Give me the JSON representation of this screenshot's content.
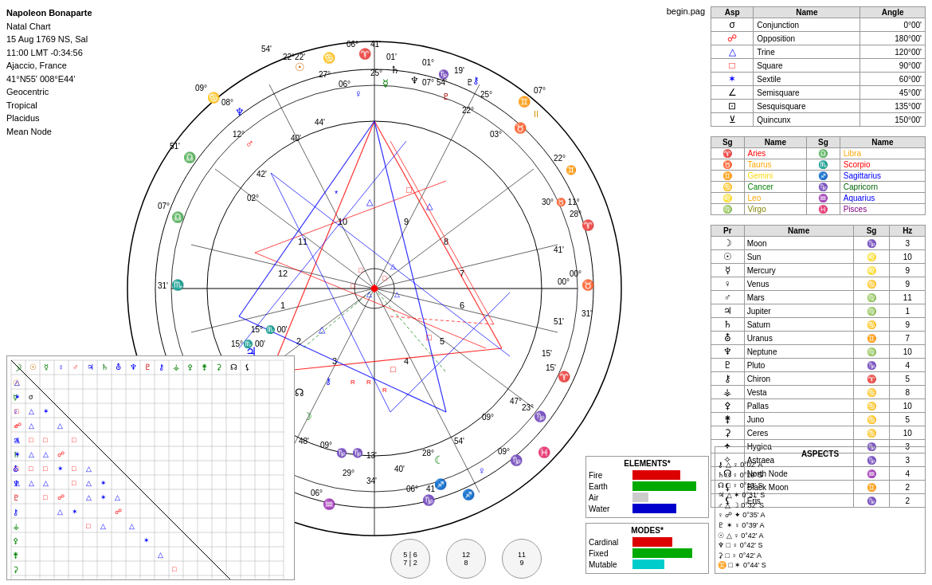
{
  "header": {
    "name": "Napoleon Bonaparte",
    "chart_type": "Natal Chart",
    "date": "15 Aug 1769 NS, Sal",
    "time": "11:00 LMT -0:34:56",
    "location": "Ajaccio, France",
    "coords": "41°N55' 008°E44'",
    "system": "Geocentric",
    "zodiac": "Tropical",
    "house": "Placidus",
    "node": "Mean Node",
    "begin_pag": "begin.pag"
  },
  "aspects_table": {
    "headers": [
      "Asp",
      "Name",
      "Angle"
    ],
    "rows": [
      {
        "symbol": "σ",
        "name": "Conjunction",
        "angle": "0°00'",
        "color": "black"
      },
      {
        "symbol": "☍",
        "name": "Opposition",
        "angle": "180°00'",
        "color": "red"
      },
      {
        "symbol": "△",
        "name": "Trine",
        "angle": "120°00'",
        "color": "blue"
      },
      {
        "symbol": "□",
        "name": "Square",
        "angle": "90°00'",
        "color": "red"
      },
      {
        "symbol": "✶",
        "name": "Sextile",
        "angle": "60°00'",
        "color": "blue"
      },
      {
        "symbol": "∠",
        "name": "Semisquare",
        "angle": "45°00'",
        "color": "black"
      },
      {
        "symbol": "⊡",
        "name": "Sesquisquare",
        "angle": "135°00'",
        "color": "black"
      },
      {
        "symbol": "⊻",
        "name": "Quincunx",
        "angle": "150°00'",
        "color": "black"
      }
    ]
  },
  "signs_table": {
    "headers": [
      "Sg",
      "Name",
      "Sg",
      "Name"
    ],
    "rows": [
      {
        "sg1": "♈",
        "name1": "Aries",
        "sg2": "♎",
        "name2": "Libra",
        "c1": "red",
        "c2": "orange"
      },
      {
        "sg1": "♉",
        "name1": "Taurus",
        "sg2": "♏",
        "name2": "Scorpio",
        "c1": "orange",
        "c2": "red"
      },
      {
        "sg1": "♊",
        "name1": "Gemini",
        "sg2": "♐",
        "name2": "Sagittarius",
        "c1": "gold",
        "c2": "blue"
      },
      {
        "sg1": "♋",
        "name1": "Cancer",
        "sg2": "♑",
        "name2": "Capricorn",
        "c1": "green",
        "c2": "darkgreen"
      },
      {
        "sg1": "♌",
        "name1": "Leo",
        "sg2": "♒",
        "name2": "Aquarius",
        "c1": "orange",
        "c2": "blue"
      },
      {
        "sg1": "♍",
        "name1": "Virgo",
        "sg2": "♓",
        "name2": "Pisces",
        "c1": "olive",
        "c2": "purple"
      }
    ]
  },
  "planets_table": {
    "headers": [
      "Pr",
      "Name",
      "Sg",
      "Hz"
    ],
    "rows": [
      {
        "pr": "☽",
        "name": "Moon",
        "sg": "♑",
        "hz": "3"
      },
      {
        "pr": "☉",
        "name": "Sun",
        "sg": "♌",
        "hz": "10"
      },
      {
        "pr": "☿",
        "name": "Mercury",
        "sg": "♌",
        "hz": "9"
      },
      {
        "pr": "♀",
        "name": "Venus",
        "sg": "♋",
        "hz": "9"
      },
      {
        "pr": "♂",
        "name": "Mars",
        "sg": "♍",
        "hz": "11"
      },
      {
        "pr": "♃",
        "name": "Jupiter",
        "sg": "♍",
        "hz": "1"
      },
      {
        "pr": "♄",
        "name": "Saturn",
        "sg": "♋",
        "hz": "9"
      },
      {
        "pr": "⛢",
        "name": "Uranus",
        "sg": "♊",
        "hz": "7"
      },
      {
        "pr": "♆",
        "name": "Neptune",
        "sg": "♍",
        "hz": "10"
      },
      {
        "pr": "♇",
        "name": "Pluto",
        "sg": "♑",
        "hz": "4"
      },
      {
        "pr": "⚷",
        "name": "Chiron",
        "sg": "♈",
        "hz": "5"
      },
      {
        "pr": "⚶",
        "name": "Vesta",
        "sg": "♋",
        "hz": "8"
      },
      {
        "pr": "⚴",
        "name": "Pallas",
        "sg": "♋",
        "hz": "10"
      },
      {
        "pr": "⚵",
        "name": "Juno",
        "sg": "♋",
        "hz": "5"
      },
      {
        "pr": "⚳",
        "name": "Ceres",
        "sg": "♋",
        "hz": "10"
      },
      {
        "pr": "✦",
        "name": "Hygiea",
        "sg": "♑",
        "hz": "3"
      },
      {
        "pr": "✧",
        "name": "Astraea",
        "sg": "♑",
        "hz": "3"
      },
      {
        "pr": "☊",
        "name": "North Node",
        "sg": "♒",
        "hz": "4"
      },
      {
        "pr": "⚸",
        "name": "Black Moon",
        "sg": "♊",
        "hz": "2"
      },
      {
        "pr": "⚸",
        "name": "Eris",
        "sg": "♑",
        "hz": "2"
      }
    ]
  },
  "elements": {
    "title": "ELEMENTS*",
    "items": [
      {
        "name": "Fire",
        "color": "#dd0000",
        "width": 60
      },
      {
        "name": "Earth",
        "color": "#00aa00",
        "width": 80
      },
      {
        "name": "Air",
        "color": "#cccccc",
        "width": 20
      },
      {
        "name": "Water",
        "color": "#0000cc",
        "width": 55
      }
    ]
  },
  "modes": {
    "title": "MODES*",
    "items": [
      {
        "name": "Cardinal",
        "color": "#dd0000",
        "width": 50
      },
      {
        "name": "Fixed",
        "color": "#00aa00",
        "width": 75
      },
      {
        "name": "Mutable",
        "color": "#00cccc",
        "width": 40
      }
    ]
  },
  "aspects_list": {
    "title": "ASPECTS",
    "rows": [
      "⚷ △ ♀  0°02' A",
      "♄ □ ♀  0°19' S",
      "☊ □ ♀  0°13' S",
      "♃ △ ✶  0°31' S",
      "♂ △ ☽  0°32' S",
      "♀ ☍ ✦  0°35' A",
      "♇ ✶ ♀  0°39' A",
      "☉ △ ♀  0°42' A",
      "♆ □ ♀  0°42' S",
      "⚳ □ ♀  0°42' A",
      "♊ □ ✶  0°44' S"
    ]
  },
  "buttons": [
    {
      "label1": "5",
      "label2": "6",
      "label3": "7",
      "label4": "2"
    },
    {
      "label1": "12",
      "label2": "8"
    },
    {
      "label1": "11",
      "label2": "9"
    }
  ]
}
